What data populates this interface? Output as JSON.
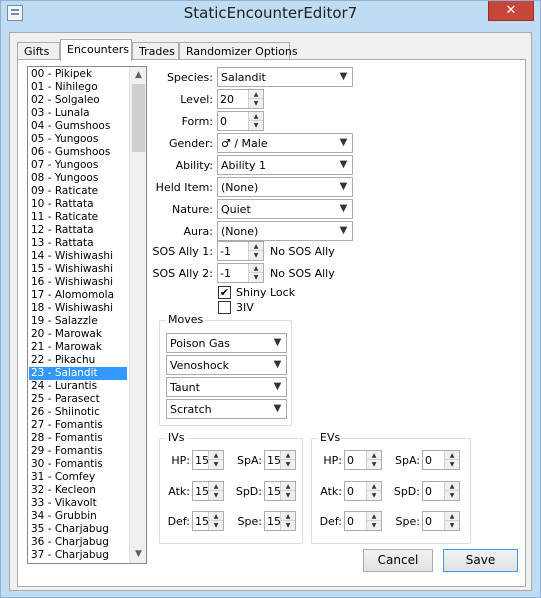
{
  "window": {
    "title": "StaticEncounterEditor7",
    "close_icon_glyph": "✕",
    "icon_name": "app-icon"
  },
  "tabs": [
    {
      "label": "Gifts",
      "active": false
    },
    {
      "label": "Encounters",
      "active": true
    },
    {
      "label": "Trades",
      "active": false
    },
    {
      "label": "Randomizer Options",
      "active": false
    }
  ],
  "encounter_list": {
    "selected_index": 23,
    "items": [
      "00 - Pikipek",
      "01 - Nihilego",
      "02 - Solgaleo",
      "03 - Lunala",
      "04 - Gumshoos",
      "05 - Yungoos",
      "06 - Gumshoos",
      "07 - Yungoos",
      "08 - Yungoos",
      "09 - Raticate",
      "10 - Rattata",
      "11 - Raticate",
      "12 - Rattata",
      "13 - Rattata",
      "14 - Wishiwashi",
      "15 - Wishiwashi",
      "16 - Wishiwashi",
      "17 - Alomomola",
      "18 - Wishiwashi",
      "19 - Salazzle",
      "20 - Marowak",
      "21 - Marowak",
      "22 - Pikachu",
      "23 - Salandit",
      "24 - Lurantis",
      "25 - Parasect",
      "26 - Shiinotic",
      "27 - Fomantis",
      "28 - Fomantis",
      "29 - Fomantis",
      "30 - Fomantis",
      "31 - Comfey",
      "32 - Kecleon",
      "33 - Vikavolt",
      "34 - Grubbin",
      "35 - Charjabug",
      "36 - Charjabug",
      "37 - Charjabug"
    ]
  },
  "form": {
    "species": {
      "label": "Species:",
      "value": "Salandit"
    },
    "level": {
      "label": "Level:",
      "value": "20"
    },
    "form": {
      "label": "Form:",
      "value": "0"
    },
    "gender": {
      "label": "Gender:",
      "value": "♂ / Male"
    },
    "ability": {
      "label": "Ability:",
      "value": "Ability 1"
    },
    "held_item": {
      "label": "Held Item:",
      "value": "(None)"
    },
    "nature": {
      "label": "Nature:",
      "value": "Quiet"
    },
    "aura": {
      "label": "Aura:",
      "value": "(None)"
    },
    "sos_ally_1": {
      "label": "SOS Ally 1:",
      "value": "-1",
      "desc": "No SOS Ally"
    },
    "sos_ally_2": {
      "label": "SOS Ally 2:",
      "value": "-1",
      "desc": "No SOS Ally"
    },
    "shiny_lock": {
      "label": "Shiny Lock",
      "checked": true,
      "mark": "✔"
    },
    "three_iv": {
      "label": "3IV",
      "checked": false,
      "mark": ""
    }
  },
  "moves": {
    "title": "Moves",
    "items": [
      "Poison Gas",
      "Venoshock",
      "Taunt",
      "Scratch"
    ]
  },
  "ivs": {
    "title": "IVs",
    "hp": {
      "label": "HP:",
      "value": "15"
    },
    "atk": {
      "label": "Atk:",
      "value": "15"
    },
    "def": {
      "label": "Def:",
      "value": "15"
    },
    "spa": {
      "label": "SpA:",
      "value": "15"
    },
    "spd": {
      "label": "SpD:",
      "value": "15"
    },
    "spe": {
      "label": "Spe:",
      "value": "15"
    }
  },
  "evs": {
    "title": "EVs",
    "hp": {
      "label": "HP:",
      "value": "0"
    },
    "atk": {
      "label": "Atk:",
      "value": "0"
    },
    "def": {
      "label": "Def:",
      "value": "0"
    },
    "spa": {
      "label": "SpA:",
      "value": "0"
    },
    "spd": {
      "label": "SpD:",
      "value": "0"
    },
    "spe": {
      "label": "Spe:",
      "value": "0"
    }
  },
  "buttons": {
    "cancel": "Cancel",
    "save": "Save"
  },
  "glyphs": {
    "dropdown": "▼",
    "up": "▲",
    "down": "▼"
  }
}
